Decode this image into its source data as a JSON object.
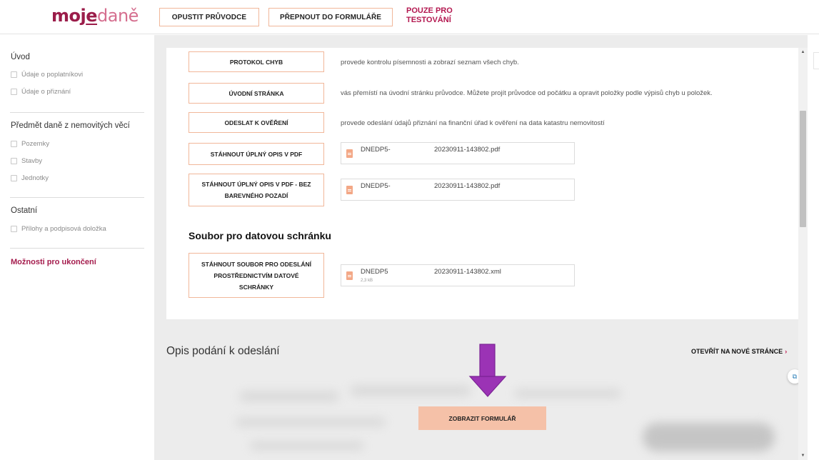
{
  "header": {
    "logo": {
      "part1": "moj",
      "part2": "e",
      "part3": "daně"
    },
    "leave_guide_label": "OPUSTIT PRŮVODCE",
    "switch_form_label": "PŘEPNOUT DO FORMULÁŘE",
    "test_label_line1": "POUZE PRO",
    "test_label_line2": "TESTOVÁNÍ"
  },
  "sidebar": {
    "sections": [
      {
        "title": "Úvod",
        "items": [
          "Údaje o poplatníkovi",
          "Údaje o přiznání"
        ]
      },
      {
        "title": "Předmět daně z nemovitých věcí",
        "items": [
          "Pozemky",
          "Stavby",
          "Jednotky"
        ]
      },
      {
        "title": "Ostatní",
        "items": [
          "Přílohy a podpisová doložka"
        ]
      }
    ],
    "active_item": "Možnosti pro ukončení"
  },
  "actions": [
    {
      "label": "PROTOKOL CHYB",
      "description": "provede kontrolu písemnosti a zobrazí seznam všech chyb."
    },
    {
      "label": "ÚVODNÍ STRÁNKA",
      "description": "vás přemístí na úvodní stránku průvodce. Můžete projít průvodce od počátku a opravit položky podle výpisů chyb u položek."
    },
    {
      "label": "ODESLAT K OVĚŘENÍ",
      "description": "provede odeslání údajů přiznání na finanční úřad k ověření na data katastru nemovitostí"
    },
    {
      "label": "STÁHNOUT ÚPLNÝ OPIS V PDF",
      "file": {
        "name": "DNEDP5-",
        "date": "20230911-143802.pdf"
      }
    },
    {
      "label_line1": "STÁHNOUT ÚPLNÝ OPIS V PDF - BEZ",
      "label_line2": "BAREVNÉHO POZADÍ",
      "file": {
        "name": "DNEDP5-",
        "date": "20230911-143802.pdf"
      }
    }
  ],
  "databox": {
    "title": "Soubor pro datovou schránku",
    "button_line1": "STÁHNOUT SOUBOR PRO ODESLÁNÍ",
    "button_line2": "PROSTŘEDNICTVÍM DATOVÉ",
    "button_line3": "SCHRÁNKY",
    "file": {
      "name": "DNEDP5",
      "date": "20230911-143802.xml",
      "size": "2,3 kB"
    }
  },
  "preview": {
    "title": "Opis podání k odeslání",
    "open_link": "OTEVŘÍT NA NOVÉ STRÁNCE",
    "open_link_chevron": "›",
    "show_form_button": "ZOBRAZIT FORMULÁŘ"
  },
  "colors": {
    "brand": "#9b1d4a",
    "accent_border": "#f1b79a",
    "primary_button": "#f5c1a8",
    "annotation_arrow": "#9b33b5"
  },
  "icons": {
    "file": "file-icon",
    "arrow": "down-arrow-annotation",
    "floating": "scan-icon"
  }
}
